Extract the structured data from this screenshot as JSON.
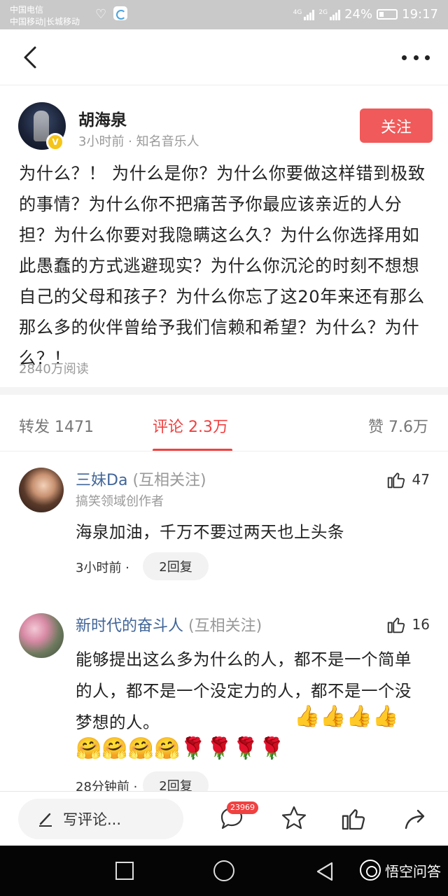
{
  "status_bar": {
    "carrier_1": "中国电信",
    "carrier_2": "中国移动|长城移动",
    "network_1": "4G",
    "network_2": "2G",
    "battery": "24%",
    "time": "19:17"
  },
  "post": {
    "author": "胡海泉",
    "meta": "3小时前 · 知名音乐人",
    "follow_label": "关注",
    "verified_badge": "V",
    "content": "为什么？！ 为什么是你？为什么你要做这样错到极致的事情？为什么你不把痛苦予你最应该亲近的人分担？为什么你要对我隐瞒这么久？为什么你选择用如此愚蠢的方式逃避现实？为什么你沉沦的时刻不想想自己的父母和孩子？为什么你忘了这20年来还有那么那么多的伙伴曾给予我们信赖和希望？为什么？为什么？！",
    "read_count": "2840万阅读"
  },
  "tabs": {
    "forward": "转发 1471",
    "comment": "评论 2.3万",
    "like": "赞 7.6万"
  },
  "comments": [
    {
      "name": "三妹Da",
      "mutual": "(互相关注)",
      "role": "搞笑领域创作者",
      "likes": "47",
      "text": "海泉加油，千万不要过两天也上头条",
      "time": "3小时前 ·",
      "replies": "2回复"
    },
    {
      "name": "新时代的奋斗人",
      "mutual": "(互相关注)",
      "likes": "16",
      "text": "能够提出这么多为什么的人，都不是一个简单的人，都不是一个没定力的人，都不是一个没梦想的人。",
      "emoji_line_1": "👍👍👍👍",
      "emoji_line_2": "🤗🤗🤗🤗🌹🌹🌹🌹",
      "time": "28分钟前 ·",
      "replies": "2回复"
    }
  ],
  "action_bar": {
    "input_placeholder": "写评论...",
    "comment_badge": "23969"
  },
  "watermark": "悟空问答",
  "colors": {
    "accent_red": "#f04141",
    "follow_button": "#f05a5a",
    "name_blue": "#406599"
  }
}
